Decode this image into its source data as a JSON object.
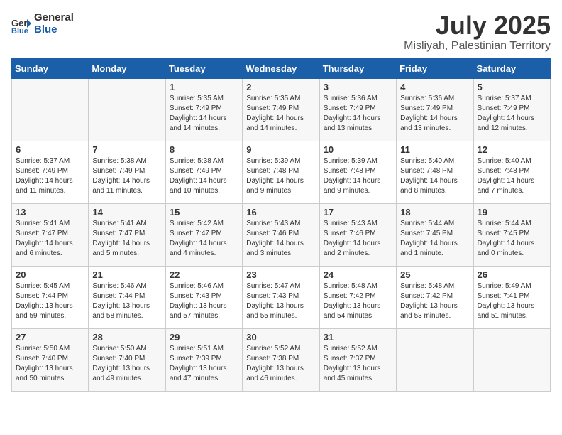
{
  "header": {
    "logo_line1": "General",
    "logo_line2": "Blue",
    "month_year": "July 2025",
    "location": "Misliyah, Palestinian Territory"
  },
  "days_of_week": [
    "Sunday",
    "Monday",
    "Tuesday",
    "Wednesday",
    "Thursday",
    "Friday",
    "Saturday"
  ],
  "weeks": [
    [
      {
        "day": "",
        "info": ""
      },
      {
        "day": "",
        "info": ""
      },
      {
        "day": "1",
        "info": "Sunrise: 5:35 AM\nSunset: 7:49 PM\nDaylight: 14 hours and 14 minutes."
      },
      {
        "day": "2",
        "info": "Sunrise: 5:35 AM\nSunset: 7:49 PM\nDaylight: 14 hours and 14 minutes."
      },
      {
        "day": "3",
        "info": "Sunrise: 5:36 AM\nSunset: 7:49 PM\nDaylight: 14 hours and 13 minutes."
      },
      {
        "day": "4",
        "info": "Sunrise: 5:36 AM\nSunset: 7:49 PM\nDaylight: 14 hours and 13 minutes."
      },
      {
        "day": "5",
        "info": "Sunrise: 5:37 AM\nSunset: 7:49 PM\nDaylight: 14 hours and 12 minutes."
      }
    ],
    [
      {
        "day": "6",
        "info": "Sunrise: 5:37 AM\nSunset: 7:49 PM\nDaylight: 14 hours and 11 minutes."
      },
      {
        "day": "7",
        "info": "Sunrise: 5:38 AM\nSunset: 7:49 PM\nDaylight: 14 hours and 11 minutes."
      },
      {
        "day": "8",
        "info": "Sunrise: 5:38 AM\nSunset: 7:49 PM\nDaylight: 14 hours and 10 minutes."
      },
      {
        "day": "9",
        "info": "Sunrise: 5:39 AM\nSunset: 7:48 PM\nDaylight: 14 hours and 9 minutes."
      },
      {
        "day": "10",
        "info": "Sunrise: 5:39 AM\nSunset: 7:48 PM\nDaylight: 14 hours and 9 minutes."
      },
      {
        "day": "11",
        "info": "Sunrise: 5:40 AM\nSunset: 7:48 PM\nDaylight: 14 hours and 8 minutes."
      },
      {
        "day": "12",
        "info": "Sunrise: 5:40 AM\nSunset: 7:48 PM\nDaylight: 14 hours and 7 minutes."
      }
    ],
    [
      {
        "day": "13",
        "info": "Sunrise: 5:41 AM\nSunset: 7:47 PM\nDaylight: 14 hours and 6 minutes."
      },
      {
        "day": "14",
        "info": "Sunrise: 5:41 AM\nSunset: 7:47 PM\nDaylight: 14 hours and 5 minutes."
      },
      {
        "day": "15",
        "info": "Sunrise: 5:42 AM\nSunset: 7:47 PM\nDaylight: 14 hours and 4 minutes."
      },
      {
        "day": "16",
        "info": "Sunrise: 5:43 AM\nSunset: 7:46 PM\nDaylight: 14 hours and 3 minutes."
      },
      {
        "day": "17",
        "info": "Sunrise: 5:43 AM\nSunset: 7:46 PM\nDaylight: 14 hours and 2 minutes."
      },
      {
        "day": "18",
        "info": "Sunrise: 5:44 AM\nSunset: 7:45 PM\nDaylight: 14 hours and 1 minute."
      },
      {
        "day": "19",
        "info": "Sunrise: 5:44 AM\nSunset: 7:45 PM\nDaylight: 14 hours and 0 minutes."
      }
    ],
    [
      {
        "day": "20",
        "info": "Sunrise: 5:45 AM\nSunset: 7:44 PM\nDaylight: 13 hours and 59 minutes."
      },
      {
        "day": "21",
        "info": "Sunrise: 5:46 AM\nSunset: 7:44 PM\nDaylight: 13 hours and 58 minutes."
      },
      {
        "day": "22",
        "info": "Sunrise: 5:46 AM\nSunset: 7:43 PM\nDaylight: 13 hours and 57 minutes."
      },
      {
        "day": "23",
        "info": "Sunrise: 5:47 AM\nSunset: 7:43 PM\nDaylight: 13 hours and 55 minutes."
      },
      {
        "day": "24",
        "info": "Sunrise: 5:48 AM\nSunset: 7:42 PM\nDaylight: 13 hours and 54 minutes."
      },
      {
        "day": "25",
        "info": "Sunrise: 5:48 AM\nSunset: 7:42 PM\nDaylight: 13 hours and 53 minutes."
      },
      {
        "day": "26",
        "info": "Sunrise: 5:49 AM\nSunset: 7:41 PM\nDaylight: 13 hours and 51 minutes."
      }
    ],
    [
      {
        "day": "27",
        "info": "Sunrise: 5:50 AM\nSunset: 7:40 PM\nDaylight: 13 hours and 50 minutes."
      },
      {
        "day": "28",
        "info": "Sunrise: 5:50 AM\nSunset: 7:40 PM\nDaylight: 13 hours and 49 minutes."
      },
      {
        "day": "29",
        "info": "Sunrise: 5:51 AM\nSunset: 7:39 PM\nDaylight: 13 hours and 47 minutes."
      },
      {
        "day": "30",
        "info": "Sunrise: 5:52 AM\nSunset: 7:38 PM\nDaylight: 13 hours and 46 minutes."
      },
      {
        "day": "31",
        "info": "Sunrise: 5:52 AM\nSunset: 7:37 PM\nDaylight: 13 hours and 45 minutes."
      },
      {
        "day": "",
        "info": ""
      },
      {
        "day": "",
        "info": ""
      }
    ]
  ]
}
